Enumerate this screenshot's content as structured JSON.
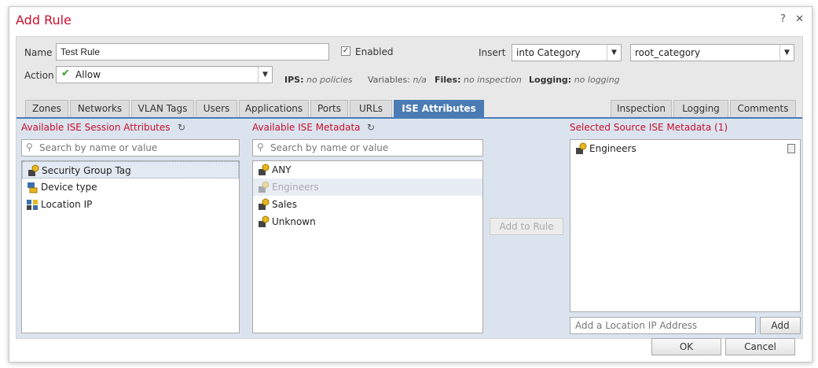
{
  "dialog": {
    "title": "Add Rule",
    "help": "?",
    "close": "✕"
  },
  "form": {
    "name_label": "Name",
    "name_value": "Test Rule",
    "enabled_label": "Enabled",
    "insert_label": "Insert",
    "insert_value": "into Category",
    "category_value": "root_category",
    "action_label": "Action",
    "action_value": "Allow",
    "ips_label": "IPS:",
    "ips_value": "no policies",
    "variables_label": "Variables:",
    "variables_value": "n/a",
    "files_label": "Files:",
    "files_value": "no inspection",
    "logging_label": "Logging:",
    "logging_value": "no logging"
  },
  "tabs_left": [
    "Zones",
    "Networks",
    "VLAN Tags",
    "Users",
    "Applications",
    "Ports",
    "URLs",
    "ISE Attributes"
  ],
  "tabs_right": [
    "Inspection",
    "Logging",
    "Comments"
  ],
  "active_tab": "ISE Attributes",
  "session": {
    "title": "Available ISE Session Attributes",
    "search_placeholder": "Search by name or value",
    "items": [
      "Security Group Tag",
      "Device type",
      "Location IP"
    ]
  },
  "metadata": {
    "title": "Available ISE Metadata",
    "search_placeholder": "Search by name or value",
    "items": [
      "ANY",
      "Engineers",
      "Sales",
      "Unknown"
    ]
  },
  "add_to_rule": "Add to Rule",
  "selected": {
    "title": "Selected Source ISE Metadata (1)",
    "items": [
      "Engineers"
    ],
    "location_placeholder": "Add a Location IP Address",
    "add_label": "Add"
  },
  "footer": {
    "ok": "OK",
    "cancel": "Cancel"
  },
  "colors": {
    "accent": "#4a7bb4",
    "title_red": "#c8102e",
    "panel_blue": "#dbe4ee"
  }
}
